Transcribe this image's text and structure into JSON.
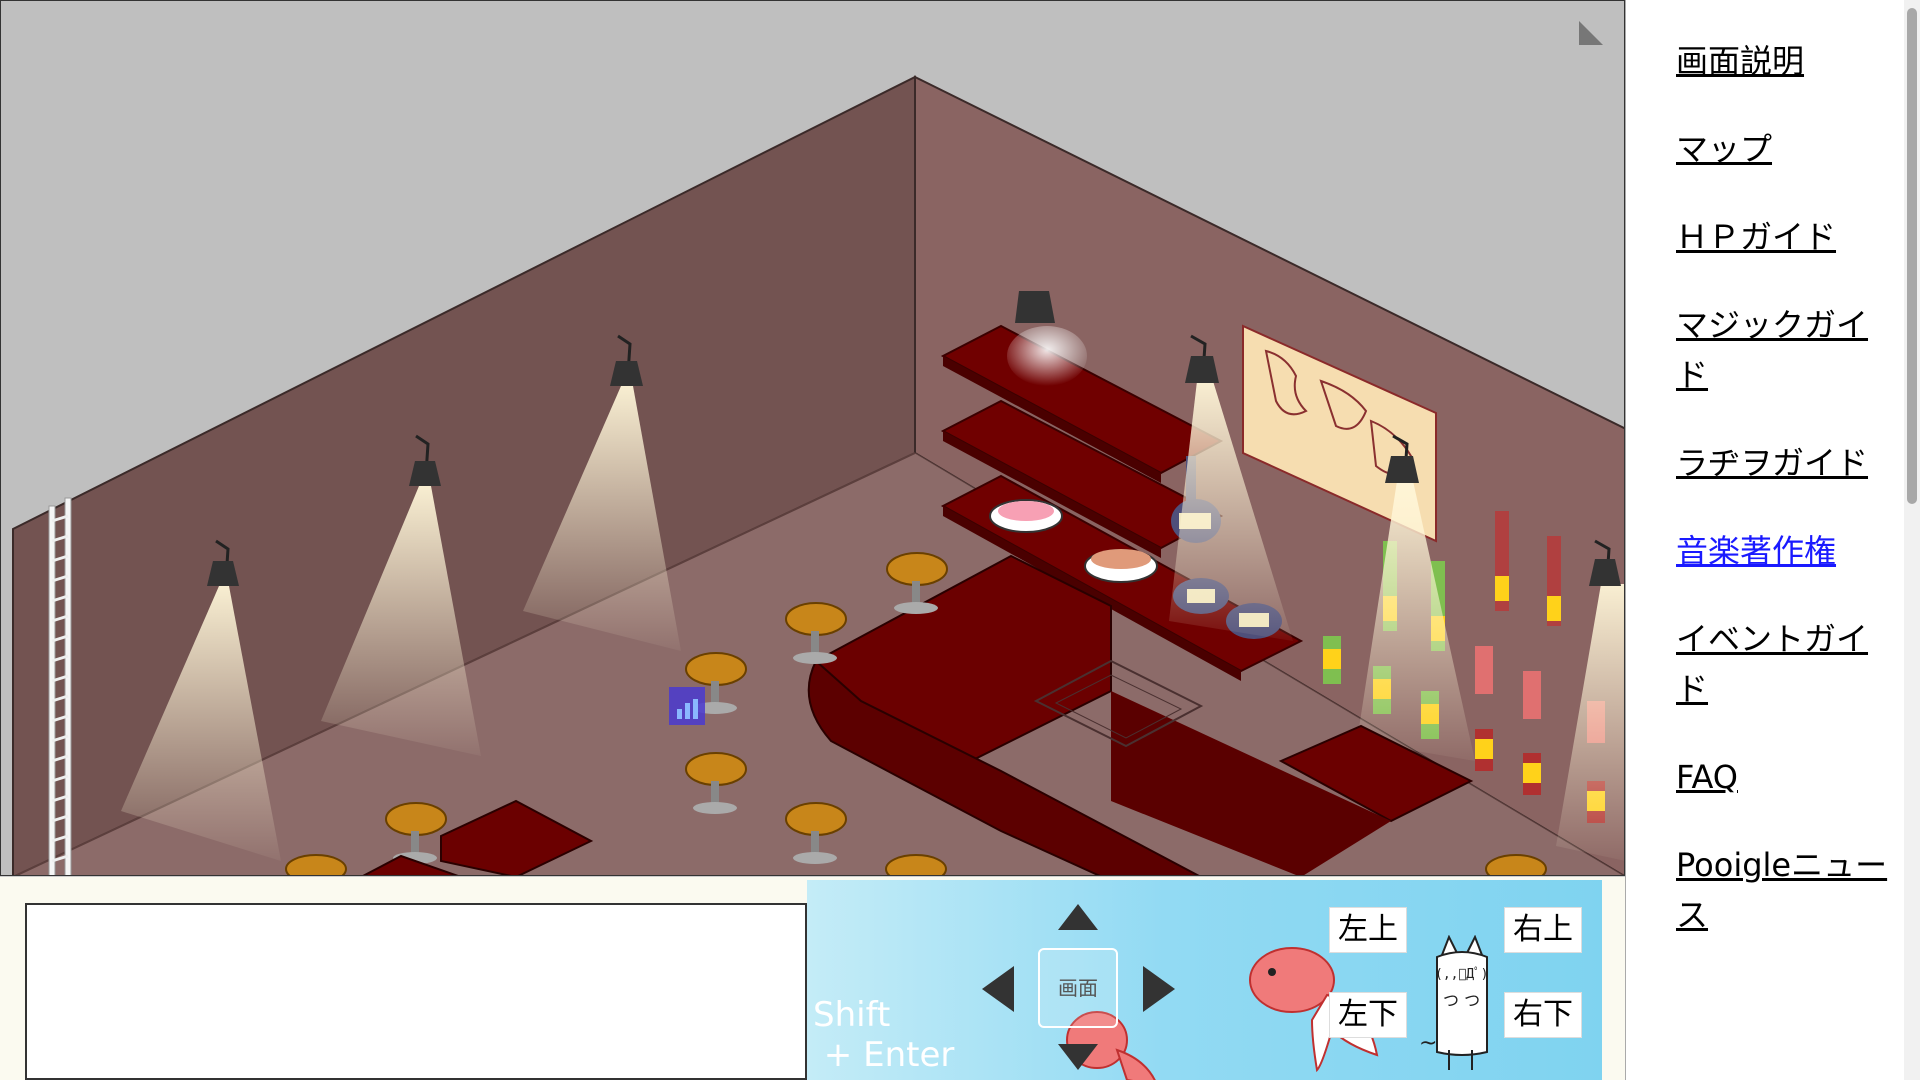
{
  "nav": {
    "items": [
      {
        "label": "画面説明",
        "visited": false
      },
      {
        "label": "マップ",
        "visited": false
      },
      {
        "label": "ＨＰガイド",
        "visited": false
      },
      {
        "label": "マジックガイド",
        "visited": false
      },
      {
        "label": "ラヂヲガイド",
        "visited": false
      },
      {
        "label": "音楽著作権",
        "visited": true
      },
      {
        "label": "イベントガイド",
        "visited": false
      },
      {
        "label": "FAQ",
        "visited": false
      },
      {
        "label": "Pooigleニュース",
        "visited": false
      }
    ]
  },
  "controls": {
    "chat_placeholder": "",
    "shift_hint": "Shift\n + Enter",
    "screen_button": "画面",
    "upper_left": "左上",
    "upper_right": "右上",
    "lower_left": "左下",
    "lower_right": "右下",
    "cat_face": "(,,ﾟДﾟ)",
    "cat_arms": "つ つ",
    "cat_tail": "~"
  },
  "colors": {
    "wall_left": "#735351",
    "wall_right": "#8a6462",
    "floor": "#8c6b69",
    "bar": "#6b0000",
    "pad_blue": "#92daf3",
    "link_visited": "#1a1aff"
  },
  "icons": [
    "resize-corner-icon",
    "spotlight-icon",
    "stool-icon",
    "goldfish-icon",
    "cat-icon",
    "arrow-up-icon",
    "arrow-down-icon",
    "arrow-left-icon",
    "arrow-right-icon"
  ]
}
